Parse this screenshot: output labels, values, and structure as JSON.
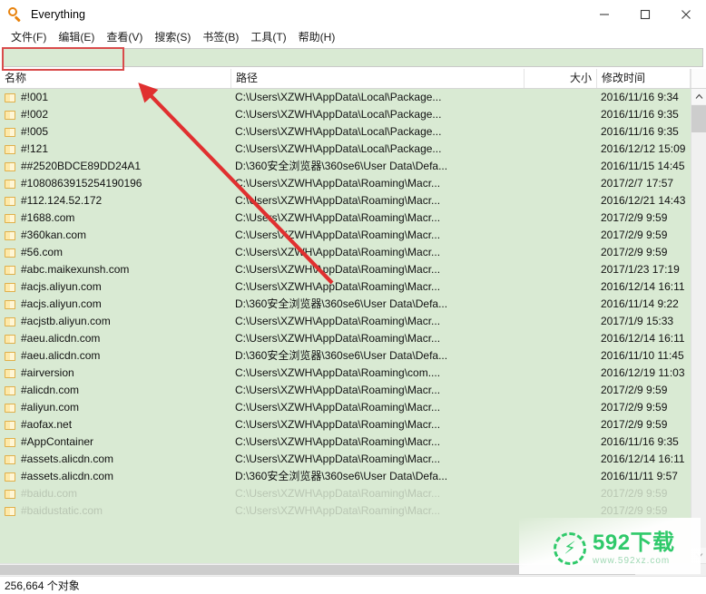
{
  "window": {
    "title": "Everything",
    "app_icon": "magnifier-icon",
    "controls": {
      "minimize": "minimize-icon",
      "maximize": "maximize-icon",
      "close": "close-icon"
    }
  },
  "menubar": {
    "items": [
      {
        "label": "文件(F)"
      },
      {
        "label": "编辑(E)"
      },
      {
        "label": "查看(V)"
      },
      {
        "label": "搜索(S)"
      },
      {
        "label": "书签(B)"
      },
      {
        "label": "工具(T)"
      },
      {
        "label": "帮助(H)"
      }
    ]
  },
  "search": {
    "value": "",
    "placeholder": "",
    "highlight_color": "#d94b4b"
  },
  "columns": {
    "name": "名称",
    "path": "路径",
    "size": "大小",
    "date_modified": "修改时间"
  },
  "rows": [
    {
      "name": "#!001",
      "path": "C:\\Users\\XZWH\\AppData\\Local\\Package...",
      "size": "",
      "date": "2016/11/16 9:34"
    },
    {
      "name": "#!002",
      "path": "C:\\Users\\XZWH\\AppData\\Local\\Package...",
      "size": "",
      "date": "2016/11/16 9:35"
    },
    {
      "name": "#!005",
      "path": "C:\\Users\\XZWH\\AppData\\Local\\Package...",
      "size": "",
      "date": "2016/11/16 9:35"
    },
    {
      "name": "#!121",
      "path": "C:\\Users\\XZWH\\AppData\\Local\\Package...",
      "size": "",
      "date": "2016/12/12 15:09"
    },
    {
      "name": "##2520BDCE89DD24A1",
      "path": "D:\\360安全浏览器\\360se6\\User Data\\Defa...",
      "size": "",
      "date": "2016/11/15 14:45"
    },
    {
      "name": "#1080863915254190196",
      "path": "C:\\Users\\XZWH\\AppData\\Roaming\\Macr...",
      "size": "",
      "date": "2017/2/7 17:57"
    },
    {
      "name": "#112.124.52.172",
      "path": "C:\\Users\\XZWH\\AppData\\Roaming\\Macr...",
      "size": "",
      "date": "2016/12/21 14:43"
    },
    {
      "name": "#1688.com",
      "path": "C:\\Users\\XZWH\\AppData\\Roaming\\Macr...",
      "size": "",
      "date": "2017/2/9 9:59"
    },
    {
      "name": "#360kan.com",
      "path": "C:\\Users\\XZWH\\AppData\\Roaming\\Macr...",
      "size": "",
      "date": "2017/2/9 9:59"
    },
    {
      "name": "#56.com",
      "path": "C:\\Users\\XZWH\\AppData\\Roaming\\Macr...",
      "size": "",
      "date": "2017/2/9 9:59"
    },
    {
      "name": "#abc.maikexunsh.com",
      "path": "C:\\Users\\XZWH\\AppData\\Roaming\\Macr...",
      "size": "",
      "date": "2017/1/23 17:19"
    },
    {
      "name": "#acjs.aliyun.com",
      "path": "C:\\Users\\XZWH\\AppData\\Roaming\\Macr...",
      "size": "",
      "date": "2016/12/14 16:11"
    },
    {
      "name": "#acjs.aliyun.com",
      "path": "D:\\360安全浏览器\\360se6\\User Data\\Defa...",
      "size": "",
      "date": "2016/11/14 9:22"
    },
    {
      "name": "#acjstb.aliyun.com",
      "path": "C:\\Users\\XZWH\\AppData\\Roaming\\Macr...",
      "size": "",
      "date": "2017/1/9 15:33"
    },
    {
      "name": "#aeu.alicdn.com",
      "path": "C:\\Users\\XZWH\\AppData\\Roaming\\Macr...",
      "size": "",
      "date": "2016/12/14 16:11"
    },
    {
      "name": "#aeu.alicdn.com",
      "path": "D:\\360安全浏览器\\360se6\\User Data\\Defa...",
      "size": "",
      "date": "2016/11/10 11:45"
    },
    {
      "name": "#airversion",
      "path": "C:\\Users\\XZWH\\AppData\\Roaming\\com....",
      "size": "",
      "date": "2016/12/19 11:03"
    },
    {
      "name": "#alicdn.com",
      "path": "C:\\Users\\XZWH\\AppData\\Roaming\\Macr...",
      "size": "",
      "date": "2017/2/9 9:59"
    },
    {
      "name": "#aliyun.com",
      "path": "C:\\Users\\XZWH\\AppData\\Roaming\\Macr...",
      "size": "",
      "date": "2017/2/9 9:59"
    },
    {
      "name": "#aofax.net",
      "path": "C:\\Users\\XZWH\\AppData\\Roaming\\Macr...",
      "size": "",
      "date": "2017/2/9 9:59"
    },
    {
      "name": "#AppContainer",
      "path": "C:\\Users\\XZWH\\AppData\\Roaming\\Macr...",
      "size": "",
      "date": "2016/11/16 9:35"
    },
    {
      "name": "#assets.alicdn.com",
      "path": "C:\\Users\\XZWH\\AppData\\Roaming\\Macr...",
      "size": "",
      "date": "2016/12/14 16:11"
    },
    {
      "name": "#assets.alicdn.com",
      "path": "D:\\360安全浏览器\\360se6\\User Data\\Defa...",
      "size": "",
      "date": "2016/11/11 9:57"
    },
    {
      "name": "#baidu.com",
      "path": "C:\\Users\\XZWH\\AppData\\Roaming\\Macr...",
      "size": "",
      "date": "2017/2/9 9:59"
    },
    {
      "name": "#baidustatic.com",
      "path": "C:\\Users\\XZWH\\AppData\\Roaming\\Macr...",
      "size": "",
      "date": "2017/2/9 9:59"
    }
  ],
  "statusbar": {
    "object_count": "256,664 个对象"
  },
  "watermark": {
    "title": "592下载",
    "subtitle": "www.592xz.com",
    "color": "#2fc96a"
  }
}
